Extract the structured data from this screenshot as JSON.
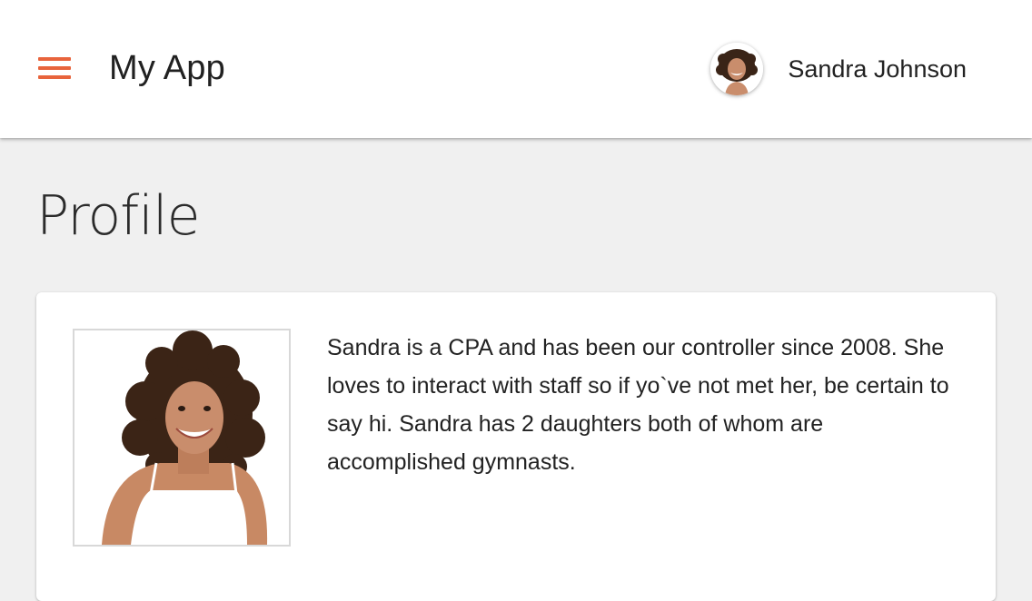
{
  "colors": {
    "accent": "#e8643c",
    "app_bar": "#ffffff",
    "page_background": "#f0f0f0",
    "card": "#ffffff"
  },
  "header": {
    "menu_icon": "hamburger-menu-icon",
    "app_title": "My App",
    "user": {
      "name": "Sandra Johnson",
      "avatar": "user-avatar-photo"
    }
  },
  "main": {
    "page_title": "Profile",
    "profile": {
      "photo": "profile-photo",
      "bio": "Sandra is a CPA and has been our controller since 2008. She loves to interact with staff so if yo`ve not met her, be certain to say hi.  Sandra has 2 daughters both of whom are accomplished gymnasts."
    }
  }
}
